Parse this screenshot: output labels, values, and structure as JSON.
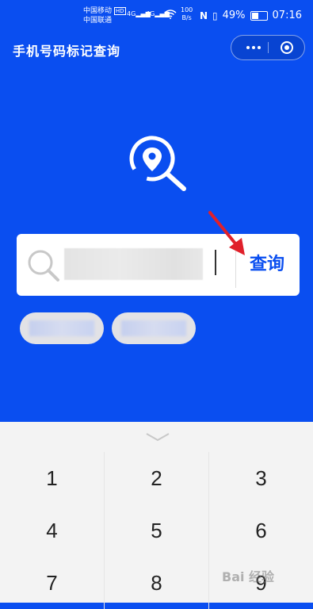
{
  "status_bar": {
    "carrier_1": "中国移动",
    "carrier_1_badge": "HD",
    "carrier_2": "中国联通",
    "signal_1": "4G",
    "signal_2": "4G",
    "net_speed_value": "100",
    "net_speed_unit": "B/s",
    "battery": "49%",
    "time": "07:16"
  },
  "header": {
    "title": "手机号码标记查询"
  },
  "search": {
    "button_label": "查询"
  },
  "keyboard": {
    "rows": [
      [
        "1",
        "2",
        "3"
      ],
      [
        "4",
        "5",
        "6"
      ],
      [
        "7",
        "8",
        "9"
      ]
    ]
  },
  "colors": {
    "brand_blue": "#0a4ef0",
    "arrow_red": "#e0202a"
  },
  "watermark": "Bai 经验"
}
